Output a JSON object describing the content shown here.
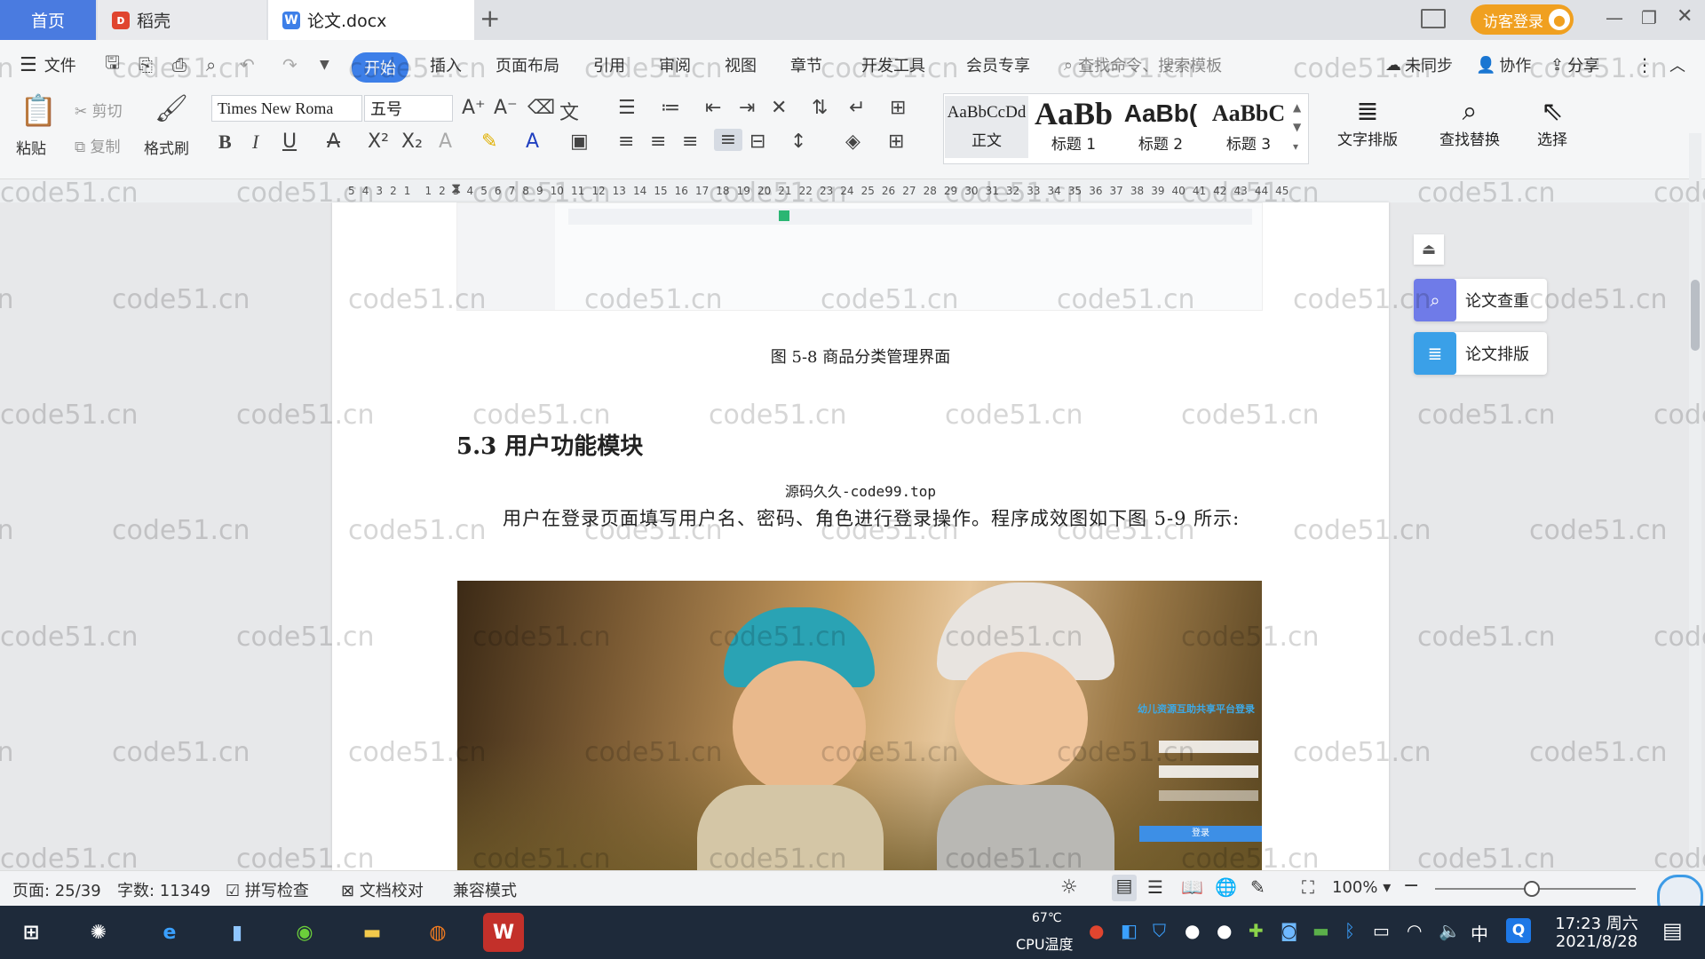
{
  "tabs": {
    "home": "首页",
    "daoke": "稻壳",
    "doc": "论文.docx",
    "add": "+"
  },
  "titlebar": {
    "login": "访客登录"
  },
  "menu": {
    "file": "文件",
    "items": [
      "开始",
      "插入",
      "页面布局",
      "引用",
      "审阅",
      "视图",
      "章节",
      "开发工具",
      "会员专享"
    ],
    "search_placeholder": "查找命令、搜索模板",
    "sync": "未同步",
    "collab": "协作",
    "share": "分享"
  },
  "ribbon": {
    "paste": "粘贴",
    "cut": "剪切",
    "copy": "复制",
    "format_painter": "格式刷",
    "font": "Times New Roma",
    "size": "五号",
    "styles": [
      {
        "sample": "AaBbCcDd",
        "name": "正文"
      },
      {
        "sample": "AaBb",
        "name": "标题 1"
      },
      {
        "sample": "AaBb(",
        "name": "标题 2"
      },
      {
        "sample": "AaBbC",
        "name": "标题 3"
      }
    ],
    "text_layout": "文字排版",
    "find_replace": "查找替换",
    "select": "选择"
  },
  "ruler_ticks": [
    "5",
    "4",
    "3",
    "2",
    "1",
    "",
    "1",
    "2",
    "3",
    "4",
    "5",
    "6",
    "7",
    "8",
    "9",
    "10",
    "11",
    "12",
    "13",
    "14",
    "15",
    "16",
    "17",
    "18",
    "19",
    "20",
    "21",
    "22",
    "23",
    "24",
    "25",
    "26",
    "27",
    "28",
    "29",
    "30",
    "31",
    "32",
    "33",
    "34",
    "35",
    "36",
    "37",
    "38",
    "39",
    "40",
    "41",
    "42",
    "43",
    "44",
    "45"
  ],
  "document": {
    "fig_caption": "图 5-8 商品分类管理界面",
    "section_heading": "5.3 用户功能模块",
    "source_note": "源码久久-code99.top",
    "paragraph": "用户在登录页面填写用户名、密码、角色进行登录操作。程序成效图如下图 5-9 所示:",
    "login_title": "幼儿资源互助共享平台登录",
    "login_btn": "登录"
  },
  "side_panel": {
    "check": "论文查重",
    "layout": "论文排版"
  },
  "status": {
    "page": "页面: 25/39",
    "words": "字数: 11349",
    "spell": "拼写检查",
    "proof": "文档校对",
    "compat": "兼容模式",
    "zoom": "100%"
  },
  "taskbar": {
    "temp": "67℃",
    "cpu": "CPU温度",
    "ime": "中",
    "time": "17:23 周六",
    "date": "2021/8/28"
  },
  "watermark": "code51.cn",
  "colors": {
    "accent": "#3d7fe8",
    "login": "#f0a020",
    "wps_red": "#d9362b"
  }
}
